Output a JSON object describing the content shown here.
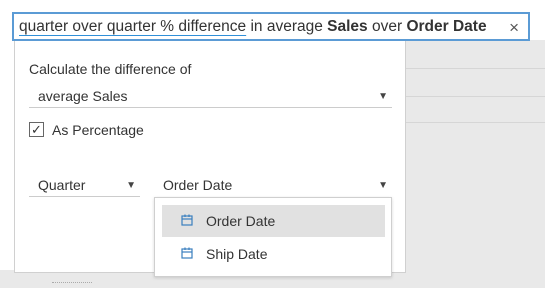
{
  "search": {
    "parts": [
      {
        "text": "quarter over quarter % difference",
        "style": "underline"
      },
      {
        "text": " in average ",
        "style": "normal"
      },
      {
        "text": "Sales",
        "style": "bold"
      },
      {
        "text": " over ",
        "style": "normal"
      },
      {
        "text": "Order Date",
        "style": "bold"
      }
    ],
    "clear_icon": "close-icon",
    "clear_glyph": "×"
  },
  "panel": {
    "calc_label": "Calculate the difference of",
    "aggregation_value": "average Sales",
    "as_percentage": {
      "label": "As Percentage",
      "checked": true,
      "glyph": "✓"
    },
    "period_value": "Quarter",
    "field_value": "Order Date"
  },
  "dropdown": {
    "options": [
      {
        "label": "Order Date",
        "icon": "calendar-icon",
        "selected": true
      },
      {
        "label": "Ship Date",
        "icon": "calendar-icon",
        "selected": false
      }
    ]
  },
  "colors": {
    "accent_border": "#5b9bd5",
    "underline": "#2f8fd8",
    "calendar_icon": "#3a7ebf",
    "selected_row": "#e1e1e1"
  }
}
